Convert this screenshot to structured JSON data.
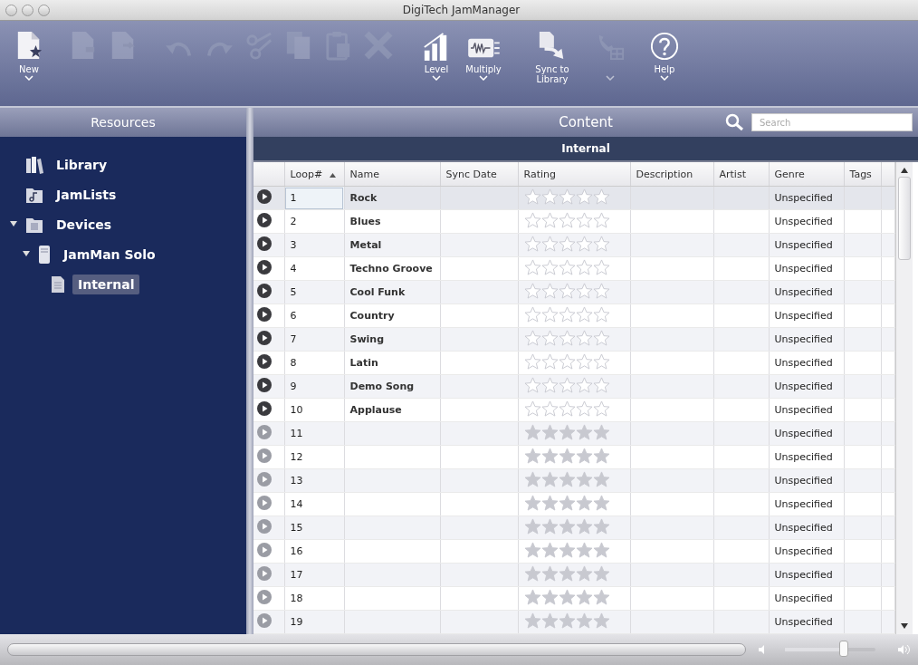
{
  "window": {
    "title": "DigiTech JamManager"
  },
  "toolbar": [
    {
      "kind": "new",
      "label": "New",
      "disabled": false,
      "menu": true
    },
    {
      "kind": "import",
      "disabled": true,
      "menu": false
    },
    {
      "kind": "export",
      "disabled": true,
      "menu": false
    },
    {
      "kind": "undo",
      "disabled": true,
      "menu": false
    },
    {
      "kind": "redo",
      "disabled": true,
      "menu": false
    },
    {
      "kind": "cut",
      "disabled": true,
      "menu": false
    },
    {
      "kind": "copy",
      "disabled": true,
      "menu": false
    },
    {
      "kind": "paste",
      "disabled": true,
      "menu": false
    },
    {
      "kind": "delete",
      "disabled": true,
      "menu": false
    },
    {
      "kind": "level",
      "label": "Level",
      "disabled": false,
      "menu": true
    },
    {
      "kind": "multiply",
      "label": "Multiply",
      "disabled": false,
      "menu": true
    },
    {
      "kind": "sync",
      "label": "Sync to Library",
      "disabled": false,
      "menu": false
    },
    {
      "kind": "send",
      "disabled": true,
      "menu": true
    },
    {
      "kind": "help",
      "label": "Help",
      "disabled": false,
      "menu": true
    }
  ],
  "sidebar": {
    "title": "Resources",
    "items": [
      {
        "label": "Library",
        "kind": "library",
        "selected": false
      },
      {
        "label": "JamLists",
        "kind": "jamlist",
        "selected": false
      },
      {
        "label": "Devices",
        "kind": "devices",
        "selected": false,
        "expanded": true,
        "children": [
          {
            "label": "JamMan Solo",
            "kind": "device",
            "selected": false,
            "expanded": true,
            "children": [
              {
                "label": "Internal",
                "kind": "memory",
                "selected": true
              }
            ]
          }
        ]
      }
    ]
  },
  "content": {
    "title": "Content",
    "search": {
      "placeholder": "Search"
    },
    "subtitle": "Internal"
  },
  "table": {
    "columns": [
      {
        "label": "Loop#",
        "sorted": true
      },
      {
        "label": "Name",
        "sorted": false
      },
      {
        "label": "Sync Date",
        "sorted": false
      },
      {
        "label": "Rating",
        "sorted": false
      },
      {
        "label": "Description",
        "sorted": false
      },
      {
        "label": "Artist",
        "sorted": false
      },
      {
        "label": "Genre",
        "sorted": false
      },
      {
        "label": "Tags",
        "sorted": false
      }
    ],
    "rows": [
      {
        "loop": "1",
        "name": "Rock",
        "genre": "Unspecified",
        "stars": 0,
        "disabled": false,
        "selected": true
      },
      {
        "loop": "2",
        "name": "Blues",
        "genre": "Unspecified",
        "stars": 0,
        "disabled": false,
        "selected": false
      },
      {
        "loop": "3",
        "name": "Metal",
        "genre": "Unspecified",
        "stars": 0,
        "disabled": false,
        "selected": false
      },
      {
        "loop": "4",
        "name": "Techno Groove",
        "genre": "Unspecified",
        "stars": 0,
        "disabled": false,
        "selected": false
      },
      {
        "loop": "5",
        "name": "Cool Funk",
        "genre": "Unspecified",
        "stars": 0,
        "disabled": false,
        "selected": false
      },
      {
        "loop": "6",
        "name": "Country",
        "genre": "Unspecified",
        "stars": 0,
        "disabled": false,
        "selected": false
      },
      {
        "loop": "7",
        "name": "Swing",
        "genre": "Unspecified",
        "stars": 0,
        "disabled": false,
        "selected": false
      },
      {
        "loop": "8",
        "name": "Latin",
        "genre": "Unspecified",
        "stars": 0,
        "disabled": false,
        "selected": false
      },
      {
        "loop": "9",
        "name": "Demo Song",
        "genre": "Unspecified",
        "stars": 0,
        "disabled": false,
        "selected": false
      },
      {
        "loop": "10",
        "name": "Applause",
        "genre": "Unspecified",
        "stars": 0,
        "disabled": false,
        "selected": false
      },
      {
        "loop": "11",
        "genre": "Unspecified",
        "stars": 0,
        "disabled": true,
        "selected": false
      },
      {
        "loop": "12",
        "genre": "Unspecified",
        "stars": 0,
        "disabled": true,
        "selected": false
      },
      {
        "loop": "13",
        "genre": "Unspecified",
        "stars": 0,
        "disabled": true,
        "selected": false
      },
      {
        "loop": "14",
        "genre": "Unspecified",
        "stars": 0,
        "disabled": true,
        "selected": false
      },
      {
        "loop": "15",
        "genre": "Unspecified",
        "stars": 0,
        "disabled": true,
        "selected": false
      },
      {
        "loop": "16",
        "genre": "Unspecified",
        "stars": 0,
        "disabled": true,
        "selected": false
      },
      {
        "loop": "17",
        "genre": "Unspecified",
        "stars": 0,
        "disabled": true,
        "selected": false
      },
      {
        "loop": "18",
        "genre": "Unspecified",
        "stars": 0,
        "disabled": true,
        "selected": false
      },
      {
        "loop": "19",
        "genre": "Unspecified",
        "stars": 0,
        "disabled": true,
        "selected": false
      }
    ]
  },
  "player": {
    "volume": {
      "level": 0.65
    }
  }
}
